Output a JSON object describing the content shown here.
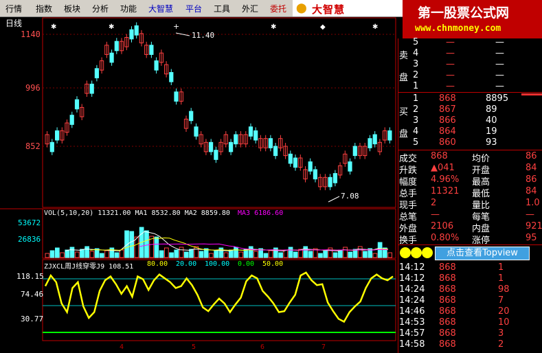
{
  "menu": {
    "items": [
      "行情",
      "指数",
      "板块",
      "分析",
      "功能",
      "大智慧",
      "平台",
      "工具",
      "外汇",
      "委托"
    ]
  },
  "brand": {
    "logo_text": "大智慧"
  },
  "watermark": {
    "line1": "第一股票公式网",
    "line2": "www.chnmoney.com"
  },
  "chart": {
    "period_label": "日线",
    "price_ticks": [
      "1140",
      "996",
      "852"
    ],
    "high_annotation": "11.40",
    "low_annotation": "7.08",
    "vol_header": "VOL(5,10,20)  11321.00  MA1  8532.80  MA2  8859.80",
    "vol_ma3": "MA3  6186.60",
    "vol_ticks": [
      "53672",
      "26836"
    ],
    "ind_header": "ZJXCL周J线穿零J9  108.51",
    "ind_levels": [
      "80.00",
      "20.00",
      "100.00",
      "0.00",
      "50.00"
    ],
    "ind_ticks": [
      "118.15",
      "74.46",
      "30.77"
    ],
    "x_ticks": [
      "4",
      "5",
      "6",
      "7"
    ]
  },
  "chart_data": {
    "type": "line",
    "title": "",
    "indicator_y": [
      96,
      118,
      104,
      60,
      42,
      92,
      104,
      54,
      30,
      42,
      86,
      108,
      116,
      100,
      80,
      96,
      74,
      116,
      110,
      88,
      108,
      120,
      112,
      104,
      92,
      96,
      112,
      98,
      78,
      52,
      44,
      58,
      70,
      60,
      42,
      58,
      72,
      106,
      118,
      112,
      86,
      74,
      60,
      42,
      44,
      62,
      78,
      118,
      124,
      108,
      98,
      100,
      62,
      44,
      28,
      22,
      42,
      54,
      64,
      92,
      112,
      120,
      112,
      108,
      116
    ],
    "price_close_approx": [
      860,
      880,
      910,
      950,
      1000,
      1050,
      1090,
      1110,
      1130,
      1140,
      1100,
      1070,
      1040,
      980,
      920,
      880,
      850,
      840,
      860,
      870,
      880,
      870,
      860,
      850,
      830,
      810,
      790,
      770,
      760,
      780,
      810,
      840,
      850,
      860,
      880
    ]
  },
  "order_book": {
    "sell": [
      {
        "side": "",
        "level": "5",
        "price": "—",
        "vol": "—"
      },
      {
        "side": "卖",
        "level": "4",
        "price": "—",
        "vol": "—"
      },
      {
        "side": "",
        "level": "3",
        "price": "—",
        "vol": "—"
      },
      {
        "side": "盘",
        "level": "2",
        "price": "—",
        "vol": "—"
      },
      {
        "side": "",
        "level": "1",
        "price": "—",
        "vol": "—"
      }
    ],
    "buy": [
      {
        "side": "",
        "level": "1",
        "price": "868",
        "vol": "8895"
      },
      {
        "side": "买",
        "level": "2",
        "price": "867",
        "vol": "89"
      },
      {
        "side": "",
        "level": "3",
        "price": "866",
        "vol": "40"
      },
      {
        "side": "盘",
        "level": "4",
        "price": "864",
        "vol": "19"
      },
      {
        "side": "",
        "level": "5",
        "price": "860",
        "vol": "93"
      }
    ]
  },
  "stats": [
    {
      "l1": "成交",
      "v1": "868",
      "l2": "均价",
      "v2": "86"
    },
    {
      "l1": "升跌",
      "v1": "▲041",
      "l2": "开盘",
      "v2": "84"
    },
    {
      "l1": "幅度",
      "v1": "4.96%",
      "l2": "最高",
      "v2": "86"
    },
    {
      "l1": "总手",
      "v1": "11321",
      "l2": "最低",
      "v2": "84"
    },
    {
      "l1": "现手",
      "v1": "2",
      "l2": "量比",
      "v2": "1.0"
    },
    {
      "l1": "总笔",
      "v1": "—",
      "l2": "每笔",
      "v2": "—"
    },
    {
      "l1": "外盘",
      "v1": "2106",
      "l2": "内盘",
      "v2": "921"
    },
    {
      "l1": "换手",
      "v1": "0.80%",
      "l2": "涨停",
      "v2": "95"
    }
  ],
  "topview": {
    "label": "点击查看Topview"
  },
  "ticks": [
    {
      "time": "14:12",
      "price": "868",
      "vol": "1"
    },
    {
      "time": "14:12",
      "price": "868",
      "vol": "1"
    },
    {
      "time": "14:24",
      "price": "868",
      "vol": "98"
    },
    {
      "time": "14:24",
      "price": "868",
      "vol": "7"
    },
    {
      "time": "14:46",
      "price": "868",
      "vol": "20"
    },
    {
      "time": "14:53",
      "price": "868",
      "vol": "10"
    },
    {
      "time": "14:57",
      "price": "868",
      "vol": "3"
    },
    {
      "time": "14:58",
      "price": "868",
      "vol": "2"
    }
  ]
}
